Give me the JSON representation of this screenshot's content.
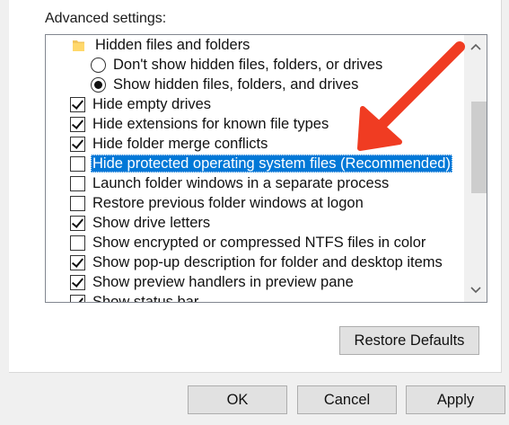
{
  "advanced_settings": {
    "label": "Advanced settings:",
    "items": [
      {
        "kind": "folder",
        "label": "Hidden files and folders",
        "icon": "folder-icon"
      },
      {
        "kind": "radio",
        "label": "Don't show hidden files, folders, or drives",
        "checked": false
      },
      {
        "kind": "radio",
        "label": "Show hidden files, folders, and drives",
        "checked": true
      },
      {
        "kind": "checkbox",
        "label": "Hide empty drives",
        "checked": true
      },
      {
        "kind": "checkbox",
        "label": "Hide extensions for known file types",
        "checked": true
      },
      {
        "kind": "checkbox",
        "label": "Hide folder merge conflicts",
        "checked": true
      },
      {
        "kind": "checkbox",
        "label": "Hide protected operating system files (Recommended)",
        "checked": false,
        "selected": true
      },
      {
        "kind": "checkbox",
        "label": "Launch folder windows in a separate process",
        "checked": false
      },
      {
        "kind": "checkbox",
        "label": "Restore previous folder windows at logon",
        "checked": false
      },
      {
        "kind": "checkbox",
        "label": "Show drive letters",
        "checked": true
      },
      {
        "kind": "checkbox",
        "label": "Show encrypted or compressed NTFS files in color",
        "checked": false
      },
      {
        "kind": "checkbox",
        "label": "Show pop-up description for folder and desktop items",
        "checked": true
      },
      {
        "kind": "checkbox",
        "label": "Show preview handlers in preview pane",
        "checked": true
      },
      {
        "kind": "checkbox",
        "label": "Show status bar",
        "checked": true
      }
    ]
  },
  "buttons": {
    "restore_defaults": "Restore Defaults",
    "ok": "OK",
    "cancel": "Cancel",
    "apply": "Apply"
  },
  "colors": {
    "selection": "#0078d7",
    "annotation_arrow": "#f03c22"
  }
}
